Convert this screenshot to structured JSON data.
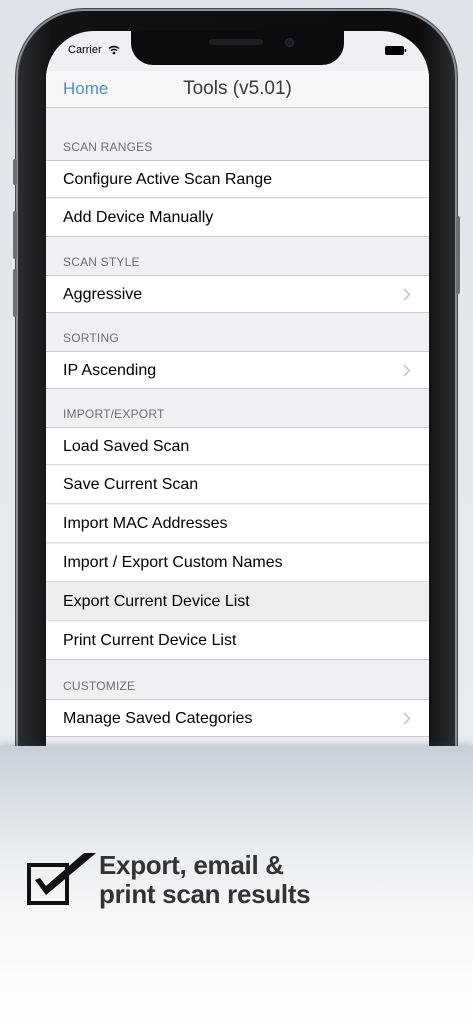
{
  "status_bar": {
    "carrier": "Carrier"
  },
  "nav": {
    "back_label": "Home",
    "title": "Tools (v5.01)"
  },
  "sections": [
    {
      "header": "SCAN RANGES",
      "rows": [
        {
          "label": "Configure Active Scan Range"
        },
        {
          "label": "Add Device Manually"
        }
      ]
    },
    {
      "header": "SCAN STYLE",
      "rows": [
        {
          "label": "Aggressive"
        }
      ]
    },
    {
      "header": "SORTING",
      "rows": [
        {
          "label": "IP Ascending"
        }
      ]
    },
    {
      "header": "IMPORT/EXPORT",
      "rows": [
        {
          "label": "Load Saved Scan"
        },
        {
          "label": "Save Current Scan"
        },
        {
          "label": "Import MAC Addresses"
        },
        {
          "label": "Import / Export Custom Names"
        },
        {
          "label": "Export Current Device List"
        },
        {
          "label": "Print Current Device List"
        }
      ]
    },
    {
      "header": "CUSTOMIZE",
      "rows": [
        {
          "label": "Manage Saved Categories"
        }
      ]
    }
  ],
  "promo": {
    "line1": "Export, email &",
    "line2": "print scan results"
  },
  "colors": {
    "accent": "#4a8fd4",
    "background": "#efeff4",
    "highlight": "#ededf0"
  }
}
